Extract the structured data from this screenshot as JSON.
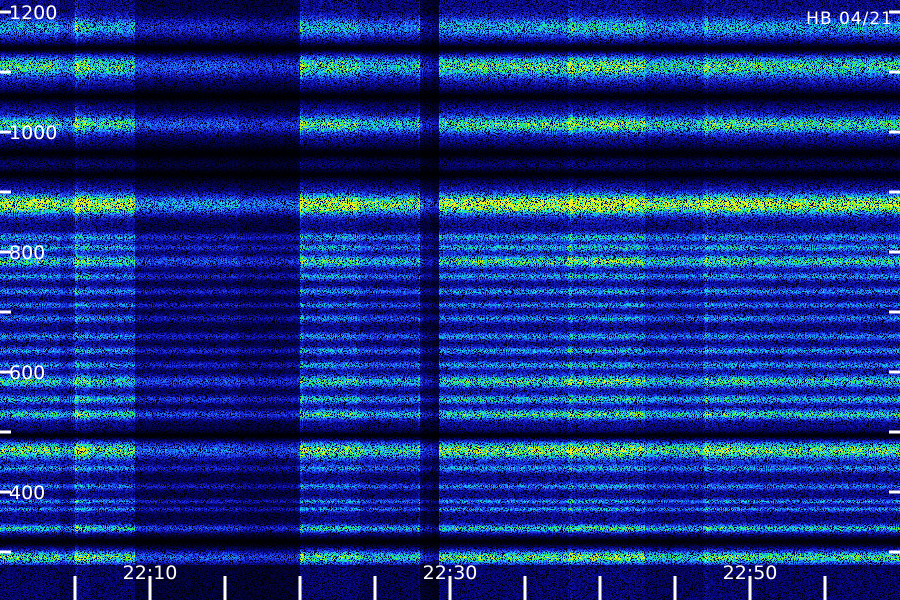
{
  "stamp": "HB 04/21",
  "chart_data": {
    "type": "heatmap",
    "title": "",
    "xlabel": "",
    "ylabel": "",
    "x_range": [
      "22:04",
      "22:59"
    ],
    "ylim": [
      280,
      1200
    ],
    "y_ticks": [
      1200,
      1000,
      800,
      600,
      400
    ],
    "y_minor_ticks": [
      1100,
      900,
      700,
      500,
      300
    ],
    "x_ticks": [
      "22:10",
      "22:30",
      "22:50"
    ],
    "x_minor_ticks": [
      "22:05",
      "22:15",
      "22:20",
      "22:25",
      "22:35",
      "22:40",
      "22:45",
      "22:55"
    ],
    "colormap": [
      "#000000",
      "#08088c",
      "#2030e8",
      "#1a88f0",
      "#18e0e0",
      "#30f030",
      "#f0f020"
    ],
    "bands": [
      {
        "center": 1175,
        "width": 16,
        "intensity": 0.36
      },
      {
        "center": 1110,
        "width": 18,
        "intensity": 0.52
      },
      {
        "center": 1013,
        "width": 14,
        "intensity": 0.52
      },
      {
        "center": 880,
        "width": 16,
        "intensity": 0.78
      },
      {
        "center": 825,
        "width": 7,
        "intensity": 0.34
      },
      {
        "center": 808,
        "width": 6,
        "intensity": 0.36
      },
      {
        "center": 785,
        "width": 10,
        "intensity": 0.5
      },
      {
        "center": 760,
        "width": 6,
        "intensity": 0.32
      },
      {
        "center": 735,
        "width": 6,
        "intensity": 0.3
      },
      {
        "center": 712,
        "width": 5,
        "intensity": 0.28
      },
      {
        "center": 690,
        "width": 6,
        "intensity": 0.28
      },
      {
        "center": 660,
        "width": 6,
        "intensity": 0.3
      },
      {
        "center": 636,
        "width": 6,
        "intensity": 0.32
      },
      {
        "center": 612,
        "width": 6,
        "intensity": 0.32
      },
      {
        "center": 585,
        "width": 10,
        "intensity": 0.48
      },
      {
        "center": 555,
        "width": 7,
        "intensity": 0.4
      },
      {
        "center": 530,
        "width": 8,
        "intensity": 0.48
      },
      {
        "center": 470,
        "width": 14,
        "intensity": 0.6
      },
      {
        "center": 440,
        "width": 6,
        "intensity": 0.3
      },
      {
        "center": 410,
        "width": 5,
        "intensity": 0.28
      },
      {
        "center": 385,
        "width": 4,
        "intensity": 0.3
      },
      {
        "center": 372,
        "width": 4,
        "intensity": 0.3
      },
      {
        "center": 340,
        "width": 6,
        "intensity": 0.45
      },
      {
        "center": 292,
        "width": 10,
        "intensity": 0.55
      }
    ],
    "dark_gaps": [
      {
        "center": 1140,
        "width": 10
      },
      {
        "center": 1060,
        "width": 12
      },
      {
        "center": 965,
        "width": 14
      },
      {
        "center": 930,
        "width": 12
      },
      {
        "center": 495,
        "width": 8
      },
      {
        "center": 318,
        "width": 10
      }
    ],
    "time_segments": [
      {
        "from": "22:04",
        "to": "22:05",
        "gain": 0.8
      },
      {
        "from": "22:05",
        "to": "22:06",
        "gain": 1.2
      },
      {
        "from": "22:06",
        "to": "22:09",
        "gain": 1.0
      },
      {
        "from": "22:09",
        "to": "22:16",
        "gain": 0.55
      },
      {
        "from": "22:16",
        "to": "22:20",
        "gain": 0.45
      },
      {
        "from": "22:20",
        "to": "22:24",
        "gain": 1.05
      },
      {
        "from": "22:24",
        "to": "22:28",
        "gain": 0.85
      },
      {
        "from": "22:28",
        "to": "22:29",
        "gain": 0.4
      },
      {
        "from": "22:29",
        "to": "22:38",
        "gain": 1.05
      },
      {
        "from": "22:38",
        "to": "22:43",
        "gain": 1.15
      },
      {
        "from": "22:43",
        "to": "22:47",
        "gain": 0.9
      },
      {
        "from": "22:47",
        "to": "22:50",
        "gain": 1.1
      },
      {
        "from": "22:50",
        "to": "22:59",
        "gain": 1.0
      }
    ],
    "bright_columns": [
      "22:05",
      "22:20",
      "22:28",
      "22:38",
      "22:47"
    ],
    "gap_column": "22:29"
  }
}
